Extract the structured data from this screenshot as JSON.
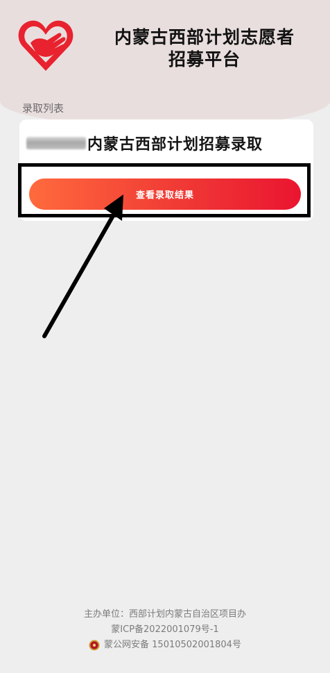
{
  "header": {
    "title_line1": "内蒙古西部计划志愿者",
    "title_line2": "招募平台"
  },
  "section": {
    "label": "录取列表"
  },
  "card": {
    "title": "内蒙古西部计划招募录取",
    "button_label": "查看录取结果"
  },
  "footer": {
    "organizer": "主办单位：西部计划内蒙古自治区项目办",
    "icp": "蒙ICP备2022001079号-1",
    "police": "蒙公网安备 15010502001804号"
  },
  "colors": {
    "accent_start": "#ff6a3d",
    "accent_end": "#ea1530",
    "header_bg": "#e9dede",
    "logo_red": "#e8222e"
  },
  "icons": [
    "heart-hand-logo-icon",
    "police-badge-icon",
    "arrow-annotation-icon"
  ]
}
